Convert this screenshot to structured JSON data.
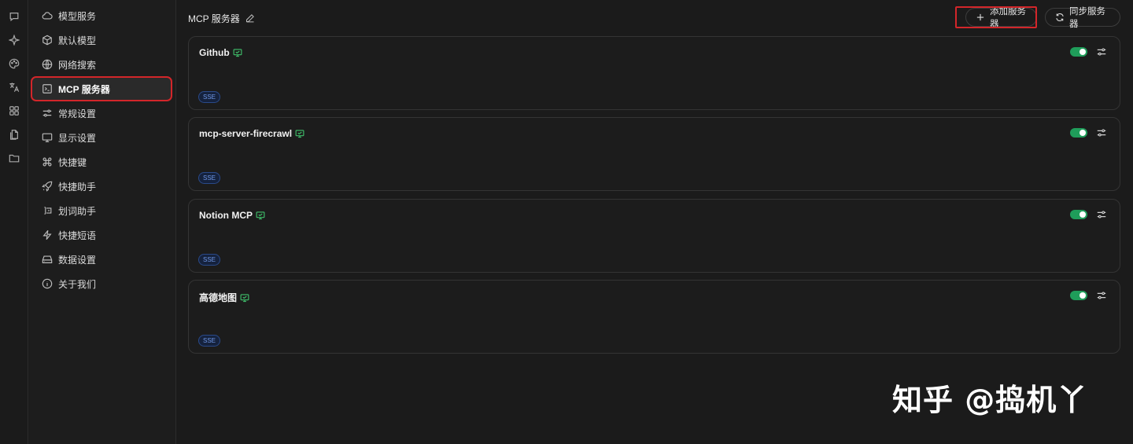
{
  "rail": {
    "icons": [
      "chat-icon",
      "sparkle-icon",
      "palette-icon",
      "translate-icon",
      "apps-grid-icon",
      "files-icon",
      "folder-icon"
    ]
  },
  "sidebar": {
    "items": [
      {
        "label": "模型服务",
        "icon": "cloud-icon"
      },
      {
        "label": "默认模型",
        "icon": "cube-icon"
      },
      {
        "label": "网络搜索",
        "icon": "globe-icon"
      },
      {
        "label": "MCP 服务器",
        "icon": "terminal-icon",
        "active": true
      },
      {
        "label": "常规设置",
        "icon": "sliders-icon"
      },
      {
        "label": "显示设置",
        "icon": "monitor-icon"
      },
      {
        "label": "快捷键",
        "icon": "command-icon"
      },
      {
        "label": "快捷助手",
        "icon": "rocket-icon"
      },
      {
        "label": "划词助手",
        "icon": "text-select-icon"
      },
      {
        "label": "快捷短语",
        "icon": "zap-icon"
      },
      {
        "label": "数据设置",
        "icon": "drive-icon"
      },
      {
        "label": "关于我们",
        "icon": "info-icon"
      }
    ]
  },
  "main": {
    "title": "MCP 服务器",
    "add_label": "添加服务器",
    "sync_label": "同步服务器",
    "servers": [
      {
        "name": "Github",
        "tag": "SSE",
        "enabled": true
      },
      {
        "name": "mcp-server-firecrawl",
        "tag": "SSE",
        "enabled": true
      },
      {
        "name": "Notion MCP",
        "tag": "SSE",
        "enabled": true
      },
      {
        "name": "高德地图",
        "tag": "SSE",
        "enabled": true
      }
    ]
  },
  "watermark": "知乎 @捣机丫",
  "colors": {
    "accent_red": "#d3262a",
    "toggle_on": "#1f9d5a",
    "tag_blue": "#6f97e6",
    "monitor_green": "#3fbf6a"
  }
}
